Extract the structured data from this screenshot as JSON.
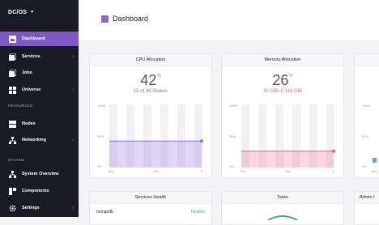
{
  "app": {
    "title": "DC/OS"
  },
  "colors": {
    "sidebar_bg": "#191a24",
    "accent": "#7d58c9",
    "cpu": "#8e6bd6",
    "memory": "#e45f89",
    "healthy": "#39b76a"
  },
  "sidebar": {
    "items": [
      {
        "label": "Dashboard",
        "icon": "dashboard-icon",
        "active": true
      },
      {
        "label": "Services",
        "icon": "services-icon",
        "chevron": true
      },
      {
        "label": "Jobs",
        "icon": "jobs-icon"
      },
      {
        "label": "Universe",
        "icon": "universe-icon",
        "chevron": true
      }
    ],
    "section_resources": "RESOURCES",
    "resources": [
      {
        "label": "Nodes",
        "icon": "nodes-icon"
      },
      {
        "label": "Networking",
        "icon": "networking-icon",
        "chevron": true
      }
    ],
    "section_system": "SYSTEM",
    "system": [
      {
        "label": "System Overview",
        "icon": "system-overview-icon"
      },
      {
        "label": "Components",
        "icon": "components-icon"
      },
      {
        "label": "Settings",
        "icon": "settings-icon",
        "chevron": true
      }
    ]
  },
  "header": {
    "title": "Dashboard"
  },
  "cards": {
    "cpu": {
      "title": "CPU Allocation",
      "percent": "42",
      "unit": "%",
      "detail": "15 of 36 Shares",
      "level": 0.42
    },
    "memory": {
      "title": "Memory Allocation",
      "percent": "26",
      "unit": "%",
      "detail": "30 GiB of 116 GiB",
      "level": 0.26
    },
    "axes": {
      "y_top": "100%",
      "y_mid": "50%",
      "y_bottom": "0%",
      "x_left": "-60s",
      "x_mid": "-30s",
      "x_right": "0"
    },
    "services_health": {
      "title": "Services Health",
      "row_name": "mongodb",
      "row_status": "Healthy"
    },
    "tasks": {
      "title": "Tasks"
    },
    "admin": {
      "title": "Admin I"
    }
  }
}
